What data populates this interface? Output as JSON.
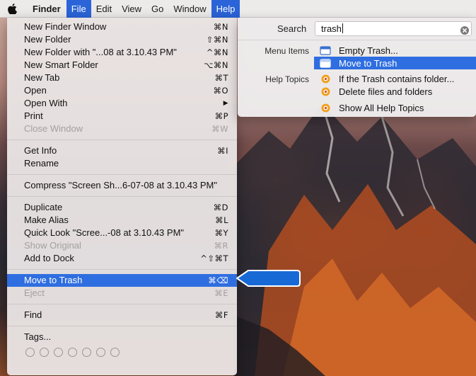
{
  "menubar": {
    "items": [
      "Finder",
      "File",
      "Edit",
      "View",
      "Go",
      "Window",
      "Help"
    ],
    "active_items": [
      "File",
      "Help"
    ]
  },
  "file_menu": {
    "items": [
      {
        "label": "New Finder Window",
        "shortcut": "⌘N"
      },
      {
        "label": "New Folder",
        "shortcut": "⇧⌘N"
      },
      {
        "label": "New Folder with \"...08 at 3.10.43 PM\"",
        "shortcut": "^⌘N"
      },
      {
        "label": "New Smart Folder",
        "shortcut": "⌥⌘N"
      },
      {
        "label": "New Tab",
        "shortcut": "⌘T"
      },
      {
        "label": "Open",
        "shortcut": "⌘O"
      },
      {
        "label": "Open With",
        "shortcut": "▶"
      },
      {
        "label": "Print",
        "shortcut": "⌘P"
      },
      {
        "label": "Close Window",
        "shortcut": "⌘W",
        "disabled": true
      },
      {
        "label": "Get Info",
        "shortcut": "⌘I"
      },
      {
        "label": "Rename",
        "shortcut": ""
      },
      {
        "label": "Compress \"Screen Sh...6-07-08 at 3.10.43 PM\"",
        "shortcut": ""
      },
      {
        "label": "Duplicate",
        "shortcut": "⌘D"
      },
      {
        "label": "Make Alias",
        "shortcut": "⌘L"
      },
      {
        "label": "Quick Look \"Scree...-08 at 3.10.43 PM\"",
        "shortcut": "⌘Y"
      },
      {
        "label": "Show Original",
        "shortcut": "⌘R",
        "disabled": true
      },
      {
        "label": "Add to Dock",
        "shortcut": "^⇧⌘T"
      },
      {
        "label": "Move to Trash",
        "shortcut": "⌘⌫",
        "highlighted": true
      },
      {
        "label": "Eject",
        "shortcut": "⌘E",
        "disabled": true
      },
      {
        "label": "Find",
        "shortcut": "⌘F"
      },
      {
        "label": "Tags...",
        "shortcut": ""
      }
    ]
  },
  "help_menu": {
    "search_label": "Search",
    "search_value": "trash",
    "menu_items_label": "Menu Items",
    "menu_items": [
      {
        "label": "Empty Trash...",
        "highlighted": false
      },
      {
        "label": "Move to Trash",
        "highlighted": true
      }
    ],
    "help_topics_label": "Help Topics",
    "help_topics": [
      "If the Trash contains folder...",
      "Delete files and folders"
    ],
    "show_all_label": "Show All Help Topics"
  },
  "colors": {
    "highlight": "#2f6ee0",
    "callout": "#1769d6",
    "tag_circle_border": "#9a9696"
  }
}
